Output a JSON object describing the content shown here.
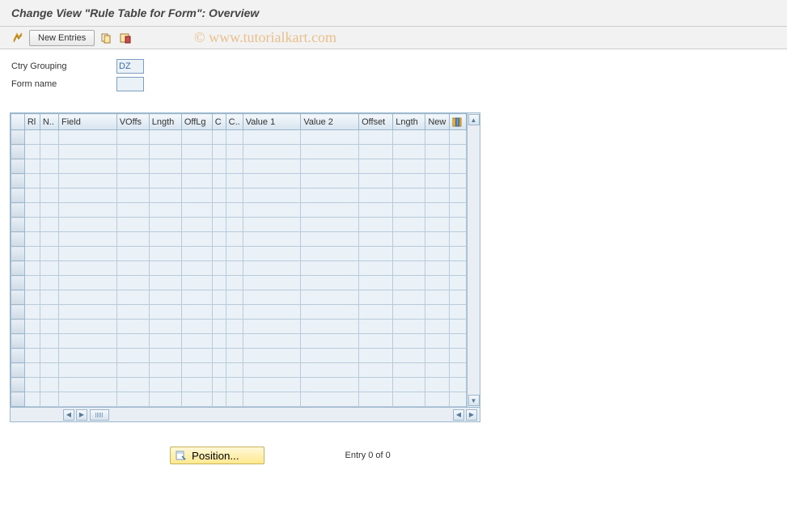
{
  "header": {
    "title": "Change View \"Rule Table for Form\": Overview"
  },
  "watermark": "© www.tutorialkart.com",
  "toolbar": {
    "new_entries": "New Entries"
  },
  "form": {
    "ctry_grouping_label": "Ctry Grouping",
    "ctry_grouping_value": "DZ",
    "form_name_label": "Form name",
    "form_name_value": ""
  },
  "table": {
    "columns": [
      "Rl",
      "N..",
      "Field",
      "VOffs",
      "Lngth",
      "OffLg",
      "C",
      "C..",
      "Value 1",
      "Value 2",
      "Offset",
      "Lngth",
      "New"
    ],
    "row_count": 19
  },
  "footer": {
    "position_label": "Position...",
    "entry_text": "Entry 0 of 0"
  }
}
